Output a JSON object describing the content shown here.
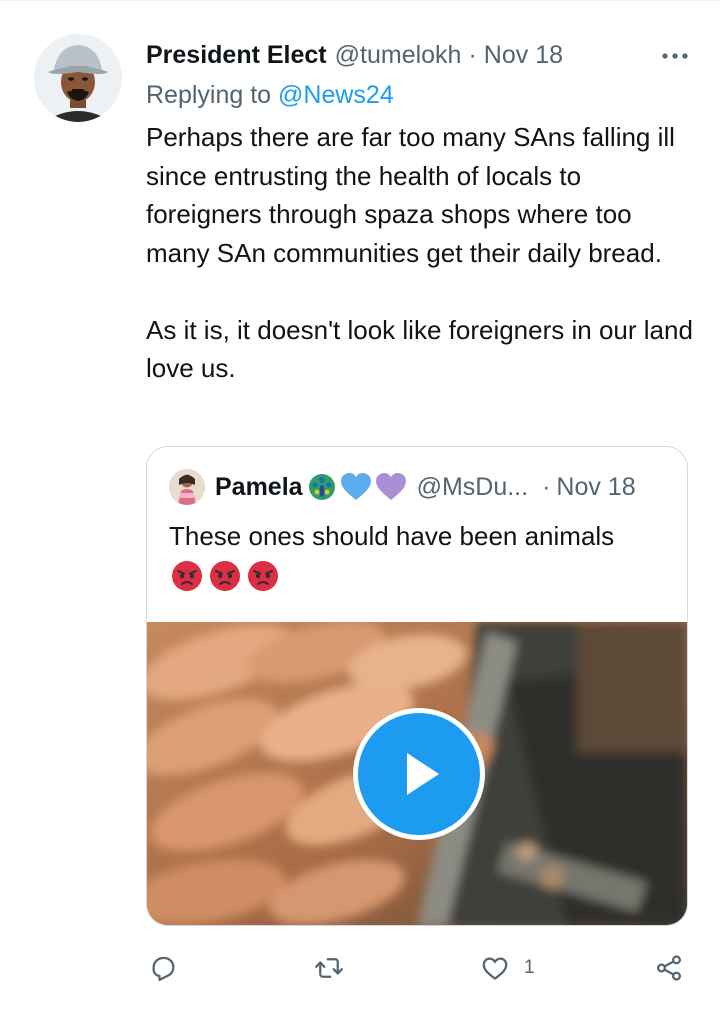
{
  "tweet": {
    "author": {
      "display_name": "President Elect",
      "handle": "@tumelokh",
      "avatar_icon": "user-avatar"
    },
    "date": "Nov 18",
    "separator": "·",
    "reply": {
      "prefix": "Replying to",
      "mention": "@News24"
    },
    "text": "Perhaps there are far too many SAns falling ill since entrusting the health of locals to foreigners through spaza shops where too many SAn communities get their daily bread.\n\nAs it is, it doesn't look like foreigners in our land love us.",
    "more_icon": "more-horizontal-icon",
    "quoted": {
      "author": {
        "display_name": "Pamela",
        "handle": "@MsDu...",
        "emojis": [
          "peacock-emoji",
          "blue-heart-emoji",
          "purple-heart-emoji"
        ]
      },
      "separator": "·",
      "date": "Nov 18",
      "text": "These ones should have been animals",
      "reaction_emojis": [
        "angry-face-emoji",
        "angry-face-emoji",
        "angry-face-emoji"
      ],
      "media": {
        "type": "video",
        "play_icon": "play-icon"
      }
    },
    "actions": {
      "reply_icon": "reply-icon",
      "retweet_icon": "retweet-icon",
      "like_icon": "heart-icon",
      "like_count": "1",
      "share_icon": "share-icon"
    },
    "colors": {
      "accent": "#1d9bf0",
      "secondary_text": "#536471",
      "border": "#cfd9de"
    }
  }
}
